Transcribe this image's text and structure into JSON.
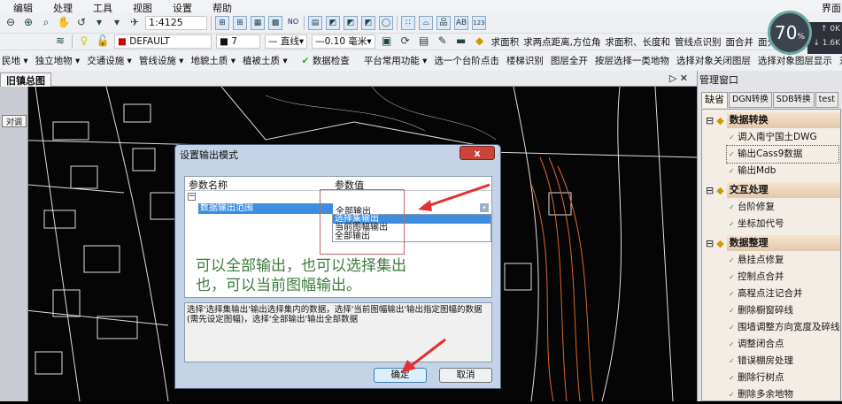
{
  "menu": [
    "编辑",
    "处理",
    "工具",
    "视图",
    "设置",
    "帮助"
  ],
  "menu_right": "界面",
  "toolbar1": {
    "scale": "1:4125",
    "icons": [
      "zoom-out",
      "zoom-in",
      "zoom-window",
      "pan",
      "redraw",
      "layer-a",
      "layer-b",
      "layer-c",
      "grid-1",
      "grid-2",
      "grid-3",
      "grid-4",
      "no"
    ],
    "text_icons": [
      "AB",
      "123"
    ]
  },
  "toolbar2": {
    "layer": "DEFAULT",
    "color_index": "7",
    "linetype": "直线",
    "lineweight": "0.10 毫米",
    "commands": [
      "求面积",
      "求两点距离,方位角",
      "求面积、长度和",
      "管线点识别",
      "面合并",
      "面分割"
    ]
  },
  "toolbar3": [
    "民地",
    "独立地物",
    "交通设施",
    "管线设施",
    "地貌土质",
    "植被土质",
    "数据检查",
    "平台常用功能",
    "选一个台阶点击",
    "楼梯识别",
    "图层全开",
    "按层选择一类地物",
    "选择对象关闭图层",
    "选择对象图层显示",
    "对象"
  ],
  "doc_tab": "旧镇总图",
  "left_panel_button": "对调",
  "gauge": {
    "percent": "70",
    "unit": "%",
    "up": "0K",
    "down": "1.6K"
  },
  "dialog": {
    "title": "设置输出模式",
    "close": "x",
    "col_name": "参数名称",
    "col_value": "参数值",
    "param_name": "数据输出范围",
    "param_value": "全部输出",
    "options": [
      "选择集输出",
      "当前图幅输出",
      "全部输出"
    ],
    "annotation_line1": "可以全部输出，也可以选择集出",
    "annotation_line2": "也，可以当前图幅输出。",
    "description": "选择'选择集输出'输出选择集内的数据，选择'当前图幅输出'输出指定图幅的数据(需先设定图幅)，选择'全部输出'输出全部数据",
    "ok": "确定",
    "cancel": "取消"
  },
  "right_panel": {
    "title": "管理窗口",
    "tabs": [
      "缺省",
      "DGN转换",
      "SDB转换",
      "test"
    ],
    "groups": [
      {
        "label": "数据转换",
        "items": [
          "调入南宁国土DWG",
          "输出Cass9数据",
          "输出Mdb"
        ]
      },
      {
        "label": "交互处理",
        "items": [
          "台阶修复",
          "坐标加代号"
        ]
      },
      {
        "label": "数据整理",
        "items": [
          "悬挂点修复",
          "控制点合并",
          "高程点注记合并",
          "删除橱窗碎线",
          "围墙调整方向宽度及碎线",
          "调整闭合点",
          "错误棚房处理",
          "删除行树点",
          "删除多余地物"
        ]
      }
    ]
  },
  "colors": {
    "arrow": "#e03030",
    "highlight": "#3d8ee0",
    "annotation": "#3d7a3d"
  }
}
